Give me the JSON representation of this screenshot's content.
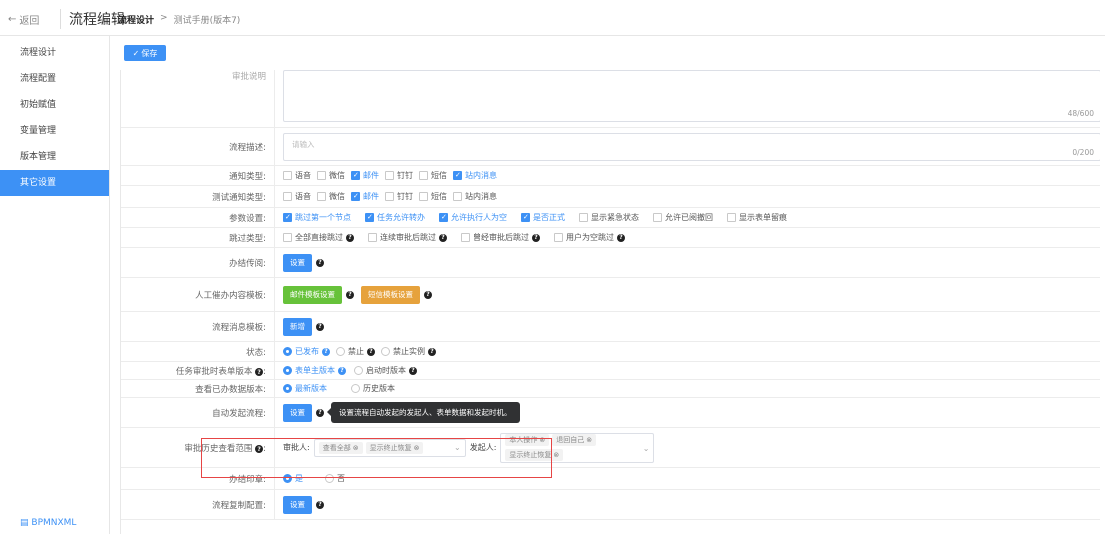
{
  "topbar": {
    "back_label": "返回",
    "app_title": "流程编辑",
    "breadcrumb_root": "流程设计",
    "breadcrumb_sep": ">",
    "breadcrumb_current": "测试手册(版本7)"
  },
  "sidebar": {
    "items": [
      {
        "label": "流程设计"
      },
      {
        "label": "流程配置"
      },
      {
        "label": "初始赋值"
      },
      {
        "label": "变量管理"
      },
      {
        "label": "版本管理"
      },
      {
        "label": "其它设置"
      }
    ],
    "active": "其它设置",
    "footer_link": "BPMNXML"
  },
  "toolbar": {
    "save_label": "保存"
  },
  "form": {
    "top_field": {
      "label": "审批说明",
      "counter": "48/600"
    },
    "description": {
      "label": "流程描述:",
      "placeholder": "请输入",
      "counter": "0/200"
    },
    "notify_type": {
      "label": "通知类型:",
      "options": [
        {
          "label": "语音",
          "checked": false
        },
        {
          "label": "微信",
          "checked": false
        },
        {
          "label": "邮件",
          "checked": true
        },
        {
          "label": "钉钉",
          "checked": false
        },
        {
          "label": "短信",
          "checked": false
        },
        {
          "label": "站内消息",
          "checked": true
        }
      ]
    },
    "test_notify_type": {
      "label": "测试通知类型:",
      "options": [
        {
          "label": "语音",
          "checked": false
        },
        {
          "label": "微信",
          "checked": false
        },
        {
          "label": "邮件",
          "checked": true
        },
        {
          "label": "钉钉",
          "checked": false
        },
        {
          "label": "短信",
          "checked": false
        },
        {
          "label": "站内消息",
          "checked": false
        }
      ]
    },
    "params": {
      "label": "参数设置:",
      "options": [
        {
          "label": "跳过第一个节点",
          "checked": true
        },
        {
          "label": "任务允许转办",
          "checked": true
        },
        {
          "label": "允许执行人为空",
          "checked": true
        },
        {
          "label": "是否正式",
          "checked": true
        },
        {
          "label": "显示紧急状态",
          "checked": false
        },
        {
          "label": "允许已阅撤回",
          "checked": false
        },
        {
          "label": "显示表单留痕",
          "checked": false
        }
      ]
    },
    "skip_type": {
      "label": "跳过类型:",
      "options": [
        {
          "label": "全部直接跳过",
          "checked": false
        },
        {
          "label": "连续审批后跳过",
          "checked": false
        },
        {
          "label": "曾经审批后跳过",
          "checked": false
        },
        {
          "label": "用户为空跳过",
          "checked": false
        }
      ]
    },
    "cc": {
      "label": "办结传阅:",
      "button": "设置"
    },
    "reminder": {
      "label": "人工催办内容模板:",
      "email_button": "邮件模板设置",
      "sms_button": "短信模板设置"
    },
    "msg_template": {
      "label": "流程消息模板:",
      "button": "新增"
    },
    "status": {
      "label": "状态:",
      "options": [
        {
          "label": "已发布",
          "checked": true
        },
        {
          "label": "禁止",
          "checked": false
        },
        {
          "label": "禁止实例",
          "checked": false
        }
      ]
    },
    "form_version": {
      "label": "任务审批时表单版本",
      "options": [
        {
          "label": "表单主版本",
          "checked": true
        },
        {
          "label": "启动时版本",
          "checked": false
        }
      ]
    },
    "done_version": {
      "label": "查看已办数据版本:",
      "options": [
        {
          "label": "最新版本",
          "checked": true
        },
        {
          "label": "历史版本",
          "checked": false
        }
      ]
    },
    "auto_start": {
      "label": "自动发起流程:",
      "button": "设置",
      "tooltip": "设置流程自动发起的发起人、表单数据和发起时机。"
    },
    "history": {
      "label": "审批历史查看范围",
      "approver_label": "审批人:",
      "approver_tags": [
        "查看全部",
        "显示终止恢复"
      ],
      "initiator_label": "发起人:",
      "initiator_tags": [
        "本人操作",
        "退回自己",
        "显示终止恢复"
      ]
    },
    "seal": {
      "label": "办结印章:",
      "options": [
        {
          "label": "是",
          "checked": true
        },
        {
          "label": "否",
          "checked": false
        }
      ]
    },
    "copy_config": {
      "label": "流程复制配置:",
      "button": "设置"
    }
  },
  "colors": {
    "primary": "#3d91f5",
    "green": "#67c23a",
    "orange": "#e6a23c",
    "highlight": "#e64545"
  }
}
